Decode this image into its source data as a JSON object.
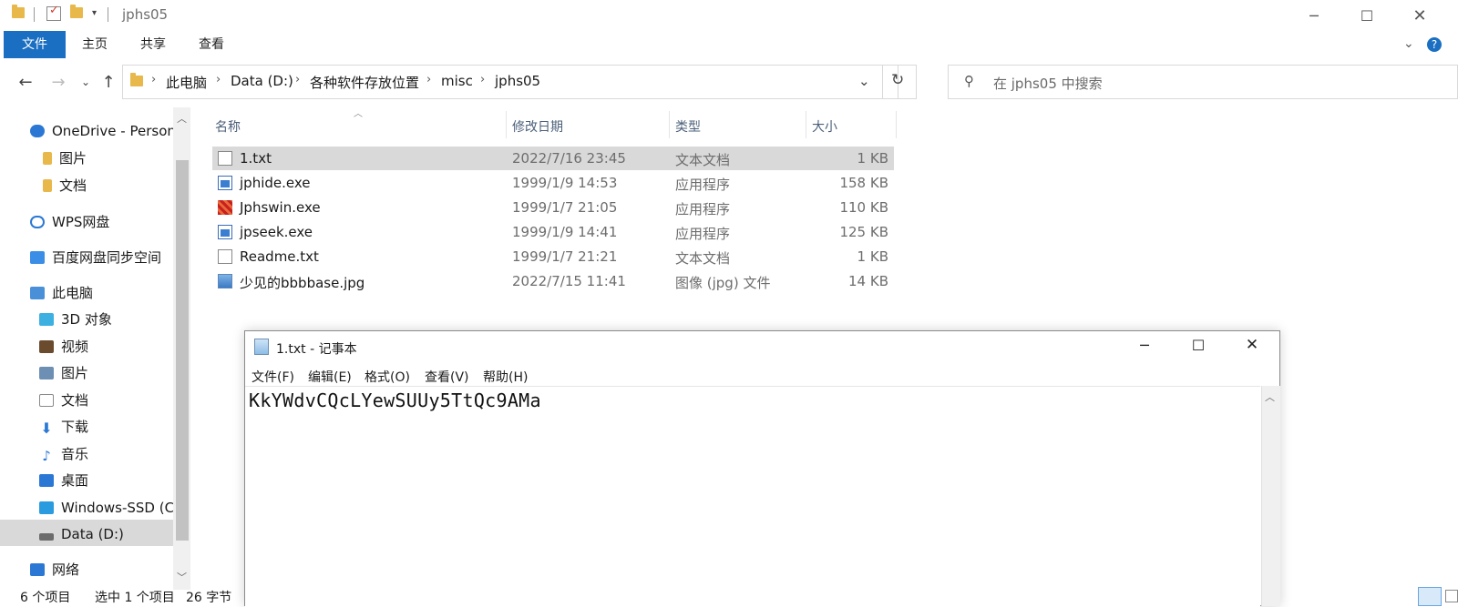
{
  "window": {
    "title": "jphs05"
  },
  "ribbon": {
    "tabs": [
      "文件",
      "主页",
      "共享",
      "查看"
    ]
  },
  "address": {
    "breadcrumbs": [
      "此电脑",
      "Data (D:)",
      "各种软件存放位置",
      "misc",
      "jphs05"
    ],
    "search_placeholder": "在 jphs05 中搜索"
  },
  "nav": {
    "items": [
      {
        "label": "OneDrive - Person",
        "icon": "onedrive-cloud-icon",
        "color": "#2b78d4"
      },
      {
        "label": "图片",
        "icon": "folder-icon",
        "color": "#e8b84a"
      },
      {
        "label": "文档",
        "icon": "folder-icon",
        "color": "#e8b84a"
      },
      {
        "label": "WPS网盘",
        "icon": "cloud-outline-icon",
        "color": "#2b78d4"
      },
      {
        "label": "百度网盘同步空间",
        "icon": "baidu-icon",
        "color": "#3a8ee6"
      },
      {
        "label": "此电脑",
        "icon": "computer-icon",
        "color": "#4a90d9"
      },
      {
        "label": "3D 对象",
        "icon": "cube-icon",
        "color": "#3cb0e0"
      },
      {
        "label": "视频",
        "icon": "film-icon",
        "color": "#6a4b2e"
      },
      {
        "label": "图片",
        "icon": "picture-icon",
        "color": "#6d8fb3"
      },
      {
        "label": "文档",
        "icon": "document-icon",
        "color": "#8a8a8a"
      },
      {
        "label": "下载",
        "icon": "download-arrow-icon",
        "color": "#2b78d4"
      },
      {
        "label": "音乐",
        "icon": "music-note-icon",
        "color": "#2b78d4"
      },
      {
        "label": "桌面",
        "icon": "desktop-icon",
        "color": "#2b78d4"
      },
      {
        "label": "Windows-SSD (C",
        "icon": "windows-drive-icon",
        "color": "#2b9be0"
      },
      {
        "label": "Data (D:)",
        "icon": "drive-icon",
        "color": "#555555"
      },
      {
        "label": "网络",
        "icon": "network-icon",
        "color": "#2b78d4"
      }
    ]
  },
  "files": {
    "columns": [
      "名称",
      "修改日期",
      "类型",
      "大小"
    ],
    "rows": [
      {
        "name": "1.txt",
        "date": "2022/7/16 23:45",
        "type": "文本文档",
        "size": "1 KB",
        "icon": "text-file-icon",
        "selected": true
      },
      {
        "name": "jphide.exe",
        "date": "1999/1/9 14:53",
        "type": "应用程序",
        "size": "158 KB",
        "icon": "exe-icon",
        "selected": false
      },
      {
        "name": "Jphswin.exe",
        "date": "1999/1/7 21:05",
        "type": "应用程序",
        "size": "110 KB",
        "icon": "jphswin-app-icon",
        "selected": false
      },
      {
        "name": "jpseek.exe",
        "date": "1999/1/9 14:41",
        "type": "应用程序",
        "size": "125 KB",
        "icon": "exe-icon",
        "selected": false
      },
      {
        "name": "Readme.txt",
        "date": "1999/1/7 21:21",
        "type": "文本文档",
        "size": "1 KB",
        "icon": "text-file-icon",
        "selected": false
      },
      {
        "name": "少见的bbbbase.jpg",
        "date": "2022/7/15 11:41",
        "type": "图像 (jpg) 文件",
        "size": "14 KB",
        "icon": "image-file-icon",
        "selected": false
      }
    ]
  },
  "status": {
    "count": "6 个项目",
    "selected": "选中 1 个项目",
    "size": "26 字节"
  },
  "notepad": {
    "title": "1.txt - 记事本",
    "menu": [
      "文件(F)",
      "编辑(E)",
      "格式(O)",
      "查看(V)",
      "帮助(H)"
    ],
    "content": "KkYWdvCQcLYewSUUy5TtQc9AMa"
  },
  "colors": {
    "accent": "#1a6fc2",
    "selection": "#d9d9d9"
  }
}
